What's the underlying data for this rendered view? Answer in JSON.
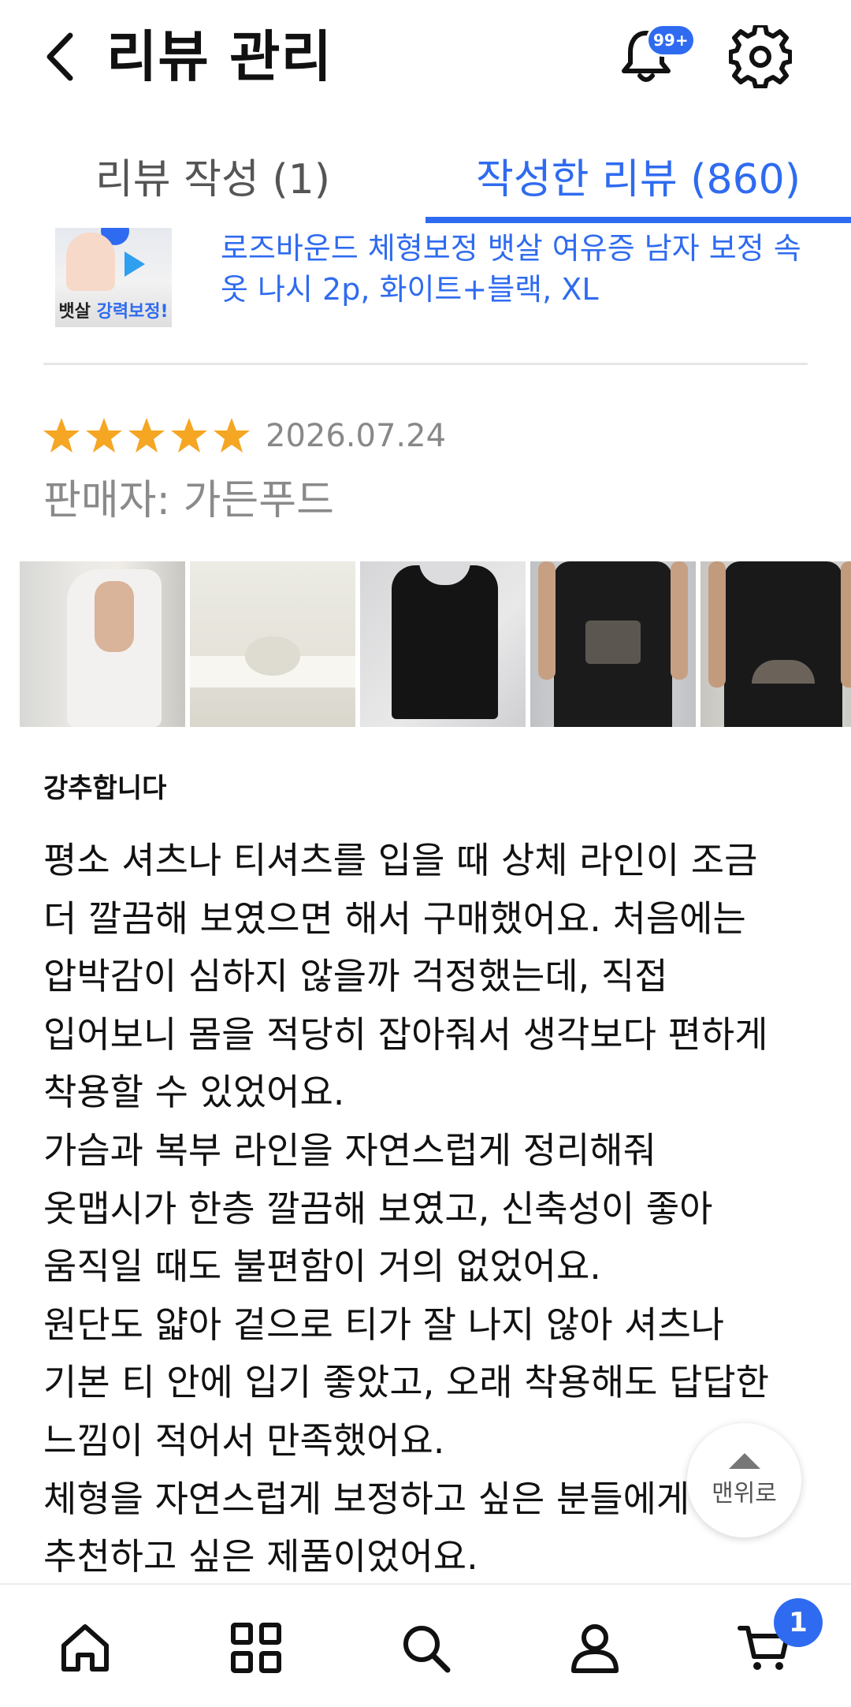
{
  "header": {
    "title": "리뷰 관리",
    "notification_badge": "99+"
  },
  "tabs": [
    {
      "label": "리뷰 작성 (1)",
      "active": false
    },
    {
      "label": "작성한 리뷰 (860)",
      "active": true
    }
  ],
  "product": {
    "name": "로즈바운드 체형보정 뱃살 여유증 남자 보정 속옷 나시 2p, 화이트+블랙, XL",
    "thumb_caption_plain": "뱃살",
    "thumb_caption_highlight": "강력보정!"
  },
  "review": {
    "rating": 5,
    "max_rating": 5,
    "date": "2026.07.24",
    "seller": "판매자: 가든푸드",
    "photo_count": 5,
    "title": "강추합니다",
    "body": "평소 셔츠나 티셔츠를 입을 때 상체 라인이 조금\n더 깔끔해 보였으면 해서 구매했어요. 처음에는\n압박감이 심하지 않을까 걱정했는데, 직접\n입어보니 몸을 적당히 잡아줘서 생각보다 편하게\n착용할 수 있었어요.\n가슴과 복부 라인을 자연스럽게 정리해줘\n옷맵시가 한층 깔끔해 보였고, 신축성이 좋아\n움직일 때도 불편함이 거의 없었어요.\n원단도 얇아 겉으로 티가 잘 나지 않아 셔츠나\n기본 티 안에 입기 좋았고, 오래 착용해도 답답한\n느낌이 적어서 만족했어요.\n체형을 자연스럽게 보정하고 싶은 분들에게\n추천하고 싶은 제품이었어요."
  },
  "scroll_top": {
    "label": "맨위로"
  },
  "bottom_nav": {
    "items": [
      "home-icon",
      "category-grid-icon",
      "search-icon",
      "profile-icon",
      "cart-icon"
    ],
    "cart_badge": "1"
  },
  "colors": {
    "accent": "#2f6bf0",
    "star": "#f5a623",
    "muted": "#888888"
  }
}
